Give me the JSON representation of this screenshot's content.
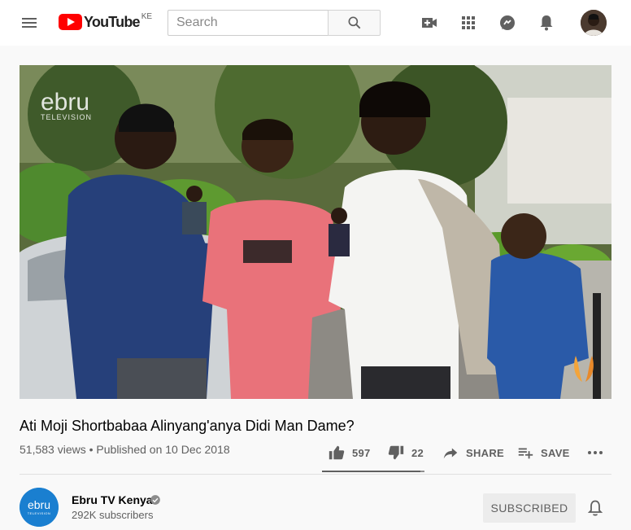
{
  "header": {
    "logo_text": "YouTube",
    "country_code": "KE",
    "search_placeholder": "Search",
    "icons": [
      "menu-icon",
      "search-icon",
      "create-video-icon",
      "apps-icon",
      "messages-icon",
      "notifications-icon"
    ]
  },
  "player": {
    "watermark": "ebru",
    "watermark_sub": "TELEVISION"
  },
  "video": {
    "title": "Ati Moji Shortbabaa Alinyang'anya Didi Man Dame?",
    "views": "51,583 views",
    "separator": "•",
    "published": "Published on 10 Dec 2018",
    "likes": "597",
    "dislikes": "22",
    "share_label": "SHARE",
    "save_label": "SAVE",
    "like_ratio": 0.964
  },
  "channel": {
    "name": "Ebru TV Kenya",
    "subscribers": "292K subscribers",
    "subscribe_label": "SUBSCRIBED",
    "avatar_text": "ebru",
    "avatar_sub": "TELEVISION"
  },
  "colors": {
    "brand_red": "#ff0000",
    "text_primary": "#030303",
    "text_secondary": "#606060",
    "ebru_blue": "#1a7fd0"
  }
}
